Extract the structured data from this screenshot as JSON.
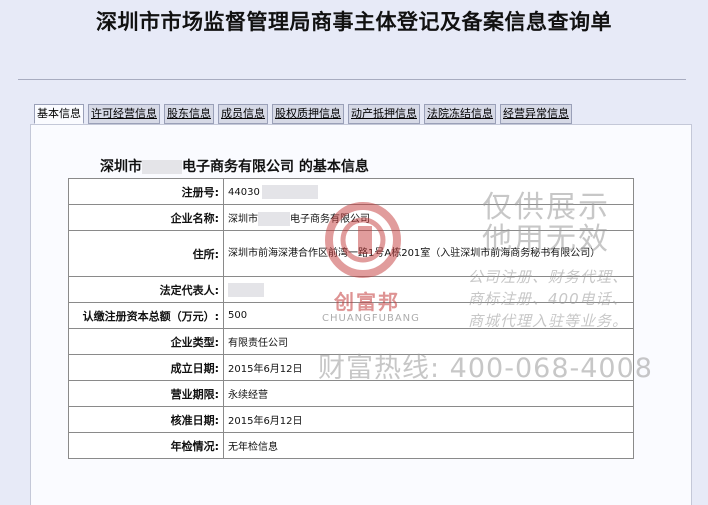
{
  "page": {
    "title": "深圳市市场监督管理局商事主体登记及备案信息查询单"
  },
  "tabs": [
    {
      "label": "基本信息"
    },
    {
      "label": "许可经营信息"
    },
    {
      "label": "股东信息"
    },
    {
      "label": "成员信息"
    },
    {
      "label": "股权质押信息"
    },
    {
      "label": "动产抵押信息"
    },
    {
      "label": "法院冻结信息"
    },
    {
      "label": "经营异常信息"
    }
  ],
  "section": {
    "prefix": "深圳市",
    "suffix": "电子商务有限公司",
    "tail": " 的基本信息"
  },
  "info": {
    "reg_no": {
      "label": "注册号:",
      "value": "44030"
    },
    "company": {
      "label": "企业名称:",
      "prefix": "深圳市",
      "suffix": "电子商务有限公司"
    },
    "address": {
      "label": "住所:",
      "value": "深圳市前海深港合作区前湾一路1号A栋201室（入驻深圳市前海商务秘书有限公司）"
    },
    "legal_rep": {
      "label": "法定代表人:",
      "value": ""
    },
    "capital": {
      "label": "认缴注册资本总额（万元）:",
      "value": "500"
    },
    "type": {
      "label": "企业类型:",
      "value": "有限责任公司"
    },
    "established": {
      "label": "成立日期:",
      "value": "2015年6月12日"
    },
    "term": {
      "label": "营业期限:",
      "value": "永续经营"
    },
    "approved": {
      "label": "核准日期:",
      "value": "2015年6月12日"
    },
    "annual": {
      "label": "年检情况:",
      "value": "无年检信息"
    }
  },
  "watermark": {
    "line1": "仅供展示",
    "line2": "他用无效",
    "service1": "公司注册、财务代理、",
    "service2": "商标注册、400电话、",
    "service3": "商城代理入驻等业务。",
    "hotline": "财富热线: 400-068-4008",
    "logo_cn": "创富邦",
    "logo_en": "CHUANGFUBANG"
  }
}
